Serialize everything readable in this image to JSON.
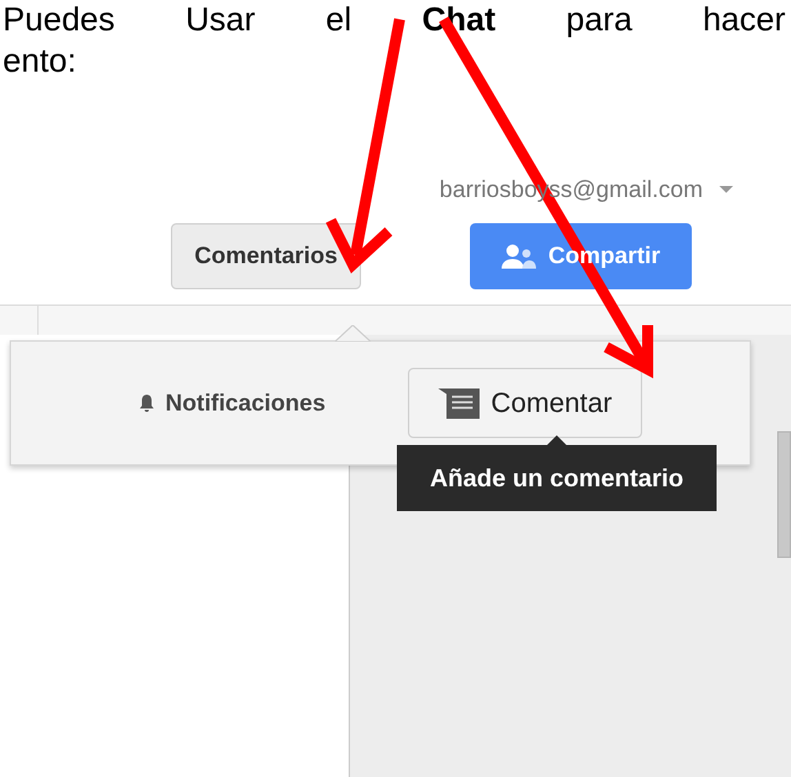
{
  "intro_text": {
    "line_1": "Puedes Usar el **Chat** para hacer",
    "line_2": "ento:"
  },
  "account": {
    "email": "barriosboyss@gmail.com"
  },
  "header_buttons": [
    {
      "label": "Comentarios",
      "kind": "default"
    },
    {
      "label": "Compartir",
      "kind": "primary"
    }
  ],
  "comments_menu": {
    "items": [
      {
        "label": "Notificaciones",
        "kind": "link"
      },
      {
        "label": "Comentar",
        "kind": "button"
      }
    ],
    "tooltip": "Añade un comentario"
  }
}
